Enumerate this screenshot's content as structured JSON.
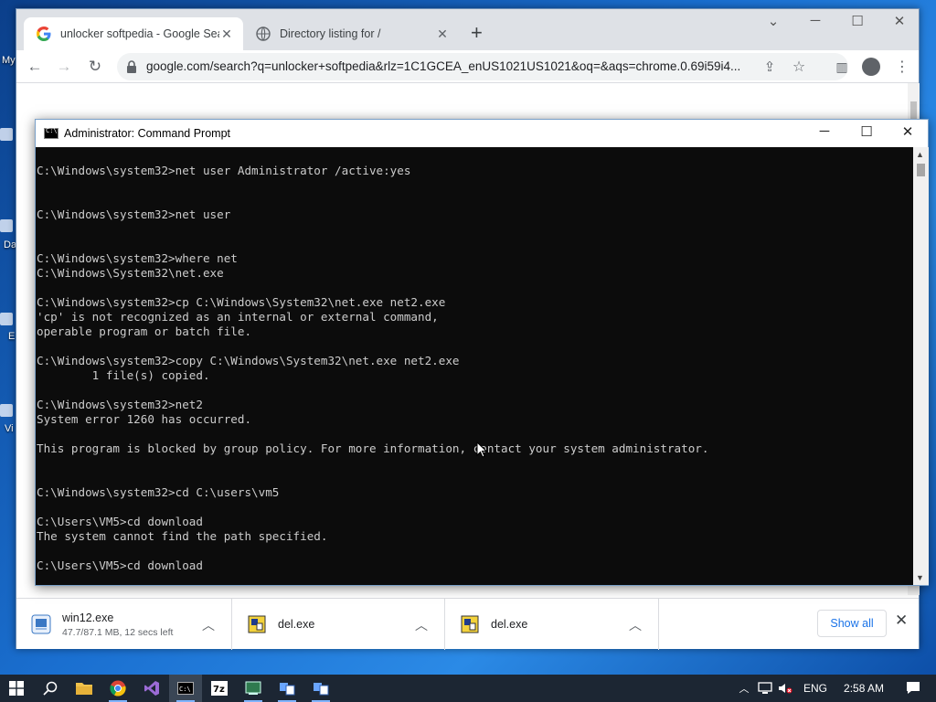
{
  "desktop": {
    "labels": [
      "My",
      "Da",
      "E",
      "Vi"
    ]
  },
  "browser": {
    "tabs": [
      {
        "title": "unlocker softpedia - Google Sear",
        "favicon": "google-g-icon",
        "active": true
      },
      {
        "title": "Directory listing for /",
        "favicon": "globe-icon",
        "active": false
      }
    ],
    "new_tab": "+",
    "url": "google.com/search?q=unlocker+softpedia&rlz=1C1GCEA_enUS1021US1021&oq=&aqs=chrome.0.69i59i4...",
    "controls": {
      "minimize": "─",
      "maximize": "☐",
      "close": "✕",
      "tab_search": "⌄"
    }
  },
  "cmd": {
    "title": "Administrator: Command Prompt",
    "controls": {
      "minimize": "─",
      "maximize": "☐",
      "close": "✕"
    },
    "lines": [
      "",
      "C:\\Windows\\system32>net user Administrator /active:yes",
      "",
      "",
      "C:\\Windows\\system32>net user",
      "",
      "",
      "C:\\Windows\\system32>where net",
      "C:\\Windows\\System32\\net.exe",
      "",
      "C:\\Windows\\system32>cp C:\\Windows\\System32\\net.exe net2.exe",
      "'cp' is not recognized as an internal or external command,",
      "operable program or batch file.",
      "",
      "C:\\Windows\\system32>copy C:\\Windows\\System32\\net.exe net2.exe",
      "        1 file(s) copied.",
      "",
      "C:\\Windows\\system32>net2",
      "System error 1260 has occurred.",
      "",
      "This program is blocked by group policy. For more information, contact your system administrator.",
      "",
      "",
      "C:\\Windows\\system32>cd C:\\users\\vm5",
      "",
      "C:\\Users\\VM5>cd download",
      "The system cannot find the path specified.",
      "",
      "C:\\Users\\VM5>cd download"
    ]
  },
  "downloads": {
    "items": [
      {
        "name": "win12.exe",
        "status": "47.7/87.1 MB, 12 secs left",
        "icon": "installer-icon"
      },
      {
        "name": "del.exe",
        "status": "",
        "icon": "exe-file-icon"
      },
      {
        "name": "del.exe",
        "status": "",
        "icon": "exe-file-icon"
      }
    ],
    "show_all": "Show all",
    "close": "✕"
  },
  "taskbar": {
    "apps": [
      "start",
      "search",
      "file-explorer",
      "chrome",
      "visual-studio",
      "command-prompt",
      "7zip",
      "app-window",
      "app-tool-1",
      "app-tool-2"
    ],
    "language": "ENG",
    "time": "2:58 AM"
  }
}
